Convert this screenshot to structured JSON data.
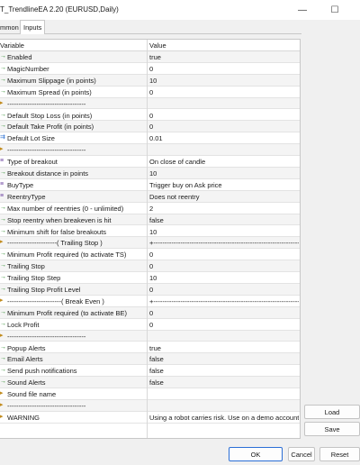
{
  "window": {
    "title": "T_TrendlineEA 2.20 (EURUSD,Daily)",
    "minimize_glyph": "—",
    "maximize_glyph": "☐",
    "close_glyph": "✕"
  },
  "tabs": [
    {
      "label": "mmon"
    },
    {
      "label": "Inputs"
    }
  ],
  "grid": {
    "headers": {
      "variable": "Variable",
      "value": "Value"
    },
    "rows": [
      {
        "icon": "arrow-icon",
        "name": "Enabled",
        "value": "true"
      },
      {
        "icon": "int-icon",
        "name": "MagicNumber",
        "value": "0"
      },
      {
        "icon": "int-icon",
        "name": "Maximum Slippage (in points)",
        "value": "10"
      },
      {
        "icon": "int-icon",
        "name": "Maximum Spread (in points)",
        "value": "0"
      },
      {
        "icon": "separator-icon",
        "name": "-----------------------------------",
        "value": ""
      },
      {
        "icon": "int-icon",
        "name": "Default Stop Loss (in points)",
        "value": "0"
      },
      {
        "icon": "int-icon",
        "name": "Default Take Profit (in points)",
        "value": "0"
      },
      {
        "icon": "double-icon",
        "name": "Default Lot Size",
        "value": "0.01"
      },
      {
        "icon": "separator-icon",
        "name": "-----------------------------------",
        "value": ""
      },
      {
        "icon": "list-icon",
        "name": "Type of breakout",
        "value": "On close of candle"
      },
      {
        "icon": "int-icon",
        "name": "Breakout distance in points",
        "value": "10"
      },
      {
        "icon": "list-icon",
        "name": "BuyType",
        "value": "Trigger buy on Ask price"
      },
      {
        "icon": "list-icon",
        "name": "ReentryType",
        "value": "Does not reentry"
      },
      {
        "icon": "int-icon",
        "name": "Max number of reentries (0 - unlimited)",
        "value": "2"
      },
      {
        "icon": "arrow-icon",
        "name": "Stop reentry when breakeven is hit",
        "value": "false"
      },
      {
        "icon": "int-icon",
        "name": "Minimum shift for false breakouts",
        "value": "10"
      },
      {
        "icon": "separator-icon",
        "name": "----------------------( Trailing Stop )",
        "value": "+--------------------------------------------------------------------"
      },
      {
        "icon": "int-icon",
        "name": "Minimum Profit required (to activate TS)",
        "value": "0"
      },
      {
        "icon": "int-icon",
        "name": "Trailing Stop",
        "value": "0"
      },
      {
        "icon": "int-icon",
        "name": "Trailing Stop Step",
        "value": "10"
      },
      {
        "icon": "int-icon",
        "name": "Trailing Stop Profit Level",
        "value": "0"
      },
      {
        "icon": "separator-icon",
        "name": "------------------------( Break Even )",
        "value": "+--------------------------------------------------------------------"
      },
      {
        "icon": "int-icon",
        "name": "Minimum Profit required (to activate BE)",
        "value": "0"
      },
      {
        "icon": "int-icon",
        "name": "Lock Profit",
        "value": "0"
      },
      {
        "icon": "separator-icon",
        "name": "-----------------------------------",
        "value": ""
      },
      {
        "icon": "arrow-icon",
        "name": "Popup Alerts",
        "value": "true"
      },
      {
        "icon": "arrow-icon",
        "name": "Email Alerts",
        "value": "false"
      },
      {
        "icon": "arrow-icon",
        "name": "Send push notifications",
        "value": "false"
      },
      {
        "icon": "arrow-icon",
        "name": "Sound Alerts",
        "value": "false"
      },
      {
        "icon": "separator-icon",
        "name": "Sound file name",
        "value": ""
      },
      {
        "icon": "separator-icon",
        "name": "-----------------------------------",
        "value": ""
      },
      {
        "icon": "separator-icon",
        "name": "WARNING",
        "value": "Using a robot carries risk. Use on a demo account ..."
      }
    ]
  },
  "buttons": {
    "load": "Load",
    "save": "Save",
    "ok": "OK",
    "cancel": "Cancel",
    "reset": "Reset"
  }
}
